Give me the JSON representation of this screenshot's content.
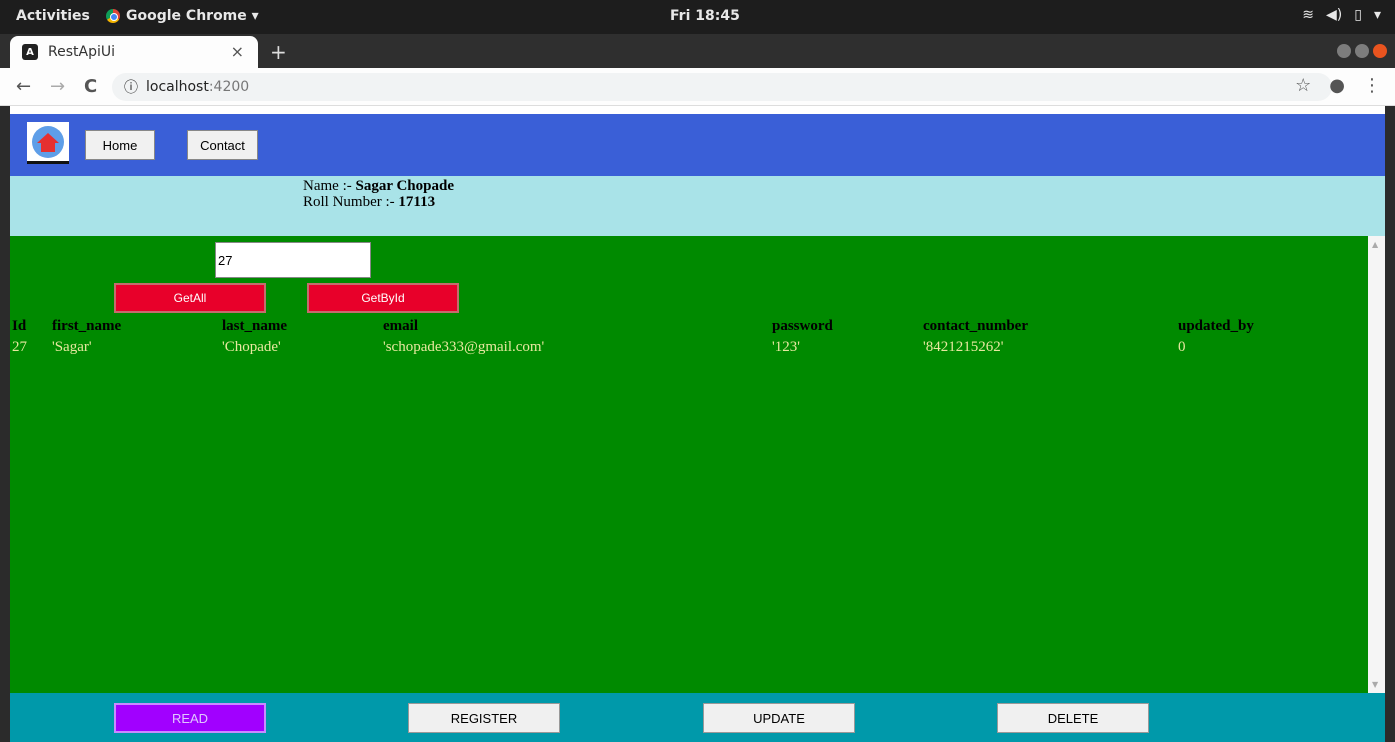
{
  "os": {
    "activities": "Activities",
    "app_name": "Google Chrome ▾",
    "clock": "Fri 18:45",
    "tray": [
      "wifi",
      "volume",
      "battery",
      "▾"
    ]
  },
  "browser": {
    "tab_title": "RestApiUi",
    "tab_close": "×",
    "new_tab": "+",
    "url_host": "localhost",
    "url_port": ":4200",
    "info_icon": "ⓘ",
    "back": "←",
    "forward": "→",
    "reload": "C",
    "star": "☆",
    "account": "●",
    "menu": "⋮"
  },
  "navbar": {
    "home_label": "Home",
    "contact_label": "Contact"
  },
  "info": {
    "name_prefix": "Name :- ",
    "name_value": "Sagar Chopade",
    "roll_prefix": "Roll Number :- ",
    "roll_value": "17113"
  },
  "form": {
    "id_value": "27",
    "getall_label": "GetAll",
    "getbyid_label": "GetById"
  },
  "table": {
    "headers": [
      "Id",
      "first_name",
      "last_name",
      "email",
      "password",
      "contact_number",
      "updated_by"
    ],
    "rows": [
      [
        "27",
        "'Sagar'",
        "'Chopade'",
        "'schopade333@gmail.com'",
        "'123'",
        "'8421215262'",
        "0"
      ]
    ]
  },
  "footer": {
    "read_label": "READ",
    "register_label": "REGISTER",
    "update_label": "UPDATE",
    "delete_label": "DELETE"
  },
  "colors": {
    "navbar": "#3a5fd7",
    "info_band": "#a9e3e8",
    "content_bg": "#008a00",
    "footer": "#0099aa",
    "action_red": "#e8002a",
    "read_active": "#a100ff"
  }
}
